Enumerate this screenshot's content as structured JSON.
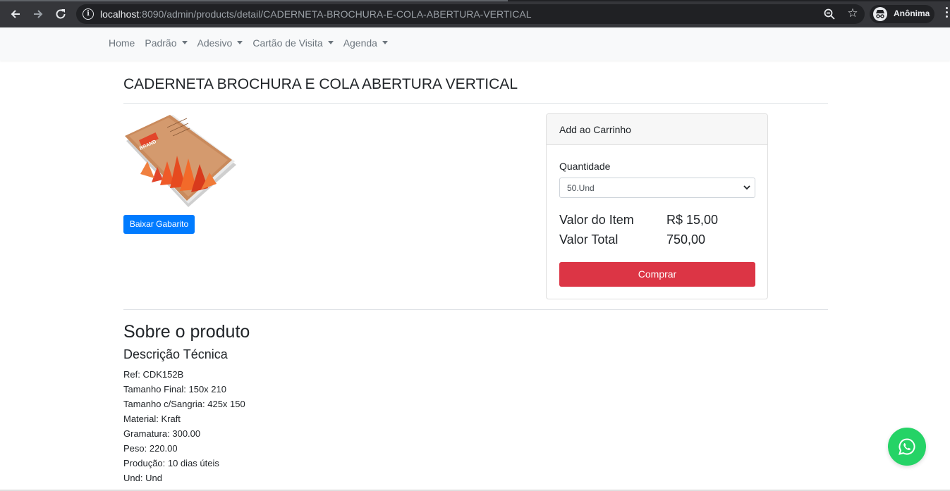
{
  "browser": {
    "url_host": "localhost",
    "url_path": ":8090/admin/products/detail/CADERNETA-BROCHURA-E-COLA-ABERTURA-VERTICAL",
    "profile_label": "Anônima",
    "back_icon": "arrow-left-icon",
    "forward_icon": "arrow-right-icon",
    "reload_icon": "reload-icon",
    "info_glyph": "i",
    "star_glyph": "☆"
  },
  "navbar": {
    "items": [
      {
        "label": "Home",
        "dropdown": false
      },
      {
        "label": "Padrão",
        "dropdown": true
      },
      {
        "label": "Adesivo",
        "dropdown": true
      },
      {
        "label": "Cartão de Visita",
        "dropdown": true
      },
      {
        "label": "Agenda",
        "dropdown": true
      }
    ]
  },
  "product": {
    "title": "CADERNETA BROCHURA E COLA ABERTURA VERTICAL",
    "image_brand_text": "BRAND",
    "download_label": "Baixar Gabarito"
  },
  "cart": {
    "header": "Add ao Carrinho",
    "quantity_label": "Quantidade",
    "quantity_selected": "50.Und",
    "item_value_label": "Valor do Item",
    "item_value": "R$ 15,00",
    "total_label": "Valor Total",
    "total_value": "750,00",
    "buy_label": "Comprar",
    "accent_color": "#dc3545"
  },
  "about": {
    "heading": "Sobre o produto",
    "subheading": "Descrição Técnica",
    "specs": [
      "Ref: CDK152B",
      "Tamanho Final: 150x 210",
      "Tamanho c/Sangria: 425x 150",
      "Material: Kraft",
      "Gramatura: 300.00",
      "Peso: 220.00",
      "Produção: 10 dias úteis",
      "Und: Und"
    ]
  },
  "colors": {
    "primary": "#007bff",
    "danger": "#dc3545",
    "whatsapp": "#25d366"
  }
}
